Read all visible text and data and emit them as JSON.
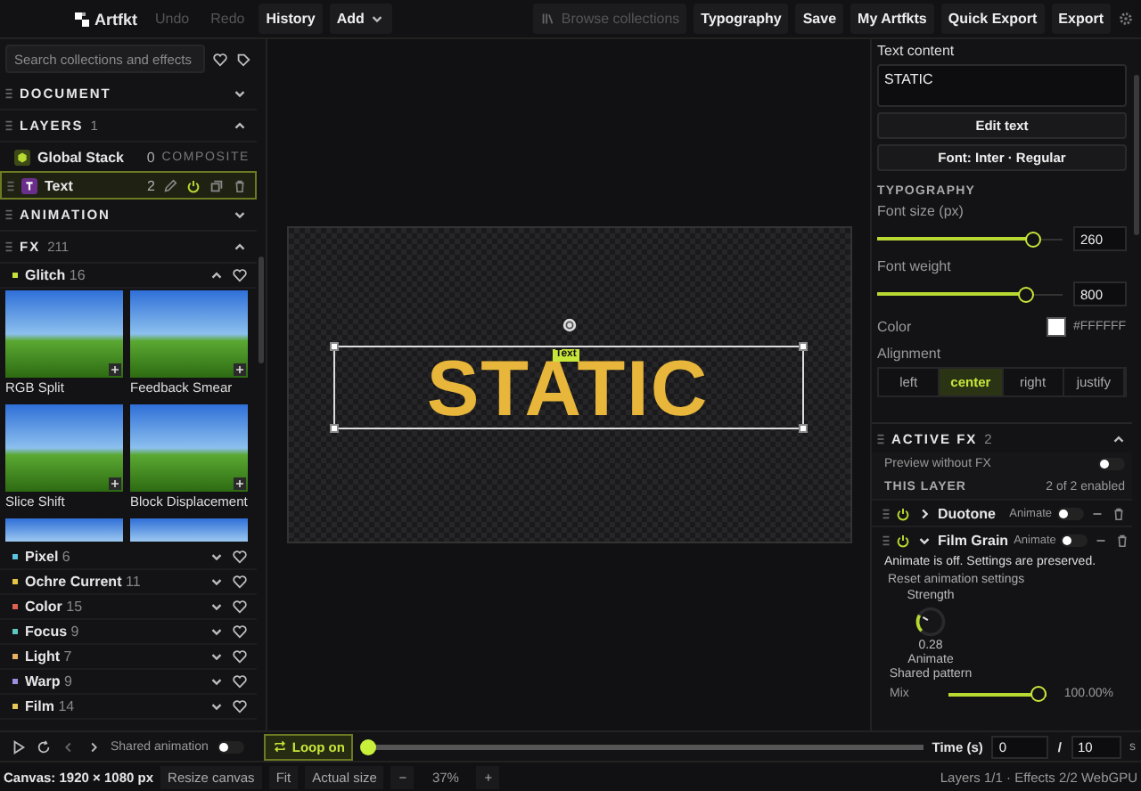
{
  "toolbar": {
    "logo": "Artfkt",
    "left_buttons": [
      {
        "label": "Undo",
        "disabled": true
      },
      {
        "label": "Redo",
        "disabled": true
      },
      {
        "label": "History",
        "disabled": false
      }
    ],
    "add_menu": "Add",
    "right_buttons": [
      {
        "label": "Browse collections",
        "disabled": true,
        "kind": "library"
      },
      {
        "label": "Typography",
        "disabled": false,
        "kind": "plain"
      },
      {
        "label": "Save",
        "disabled": false,
        "kind": "plain"
      },
      {
        "label": "My Artfkts",
        "disabled": false,
        "kind": "plain"
      },
      {
        "label": "Quick Export",
        "disabled": false,
        "kind": "plain"
      },
      {
        "label": "Export",
        "disabled": false,
        "kind": "plain"
      }
    ]
  },
  "left_panel": {
    "search": {
      "placeholder": "Search collections and effects"
    },
    "document": {
      "title": "DOCUMENT",
      "expanded": false
    },
    "layers": {
      "title": "LAYERS",
      "count": "1",
      "expanded": true,
      "items": [
        {
          "name": "Global Stack",
          "count": "0",
          "tag": "COMPOSITE",
          "kind": "stack",
          "selected": false
        },
        {
          "name": "Text",
          "count": "2",
          "kind": "text",
          "selected": true
        }
      ]
    },
    "animation": {
      "title": "ANIMATION",
      "expanded": false
    },
    "fx": {
      "title": "FX",
      "count": "211",
      "expanded": true,
      "categories": [
        {
          "name": "Glitch",
          "count": "16",
          "color": "#c6e03c",
          "expanded": true,
          "effects": [
            {
              "name": "RGB Split"
            },
            {
              "name": "Feedback Smear"
            },
            {
              "name": "Slice Shift"
            },
            {
              "name": "Block Displacement"
            }
          ]
        },
        {
          "name": "Pixel",
          "count": "6",
          "color": "#5cc3e0",
          "expanded": false
        },
        {
          "name": "Ochre Current",
          "count": "11",
          "color": "#e6c444",
          "expanded": false
        },
        {
          "name": "Color",
          "count": "15",
          "color": "#e0604e",
          "expanded": false
        },
        {
          "name": "Focus",
          "count": "9",
          "color": "#5cc9c0",
          "expanded": false
        },
        {
          "name": "Light",
          "count": "7",
          "color": "#e8b060",
          "expanded": false
        },
        {
          "name": "Warp",
          "count": "9",
          "color": "#9a8fe0",
          "expanded": false
        },
        {
          "name": "Film",
          "count": "14",
          "color": "#e6c85a",
          "expanded": false
        }
      ]
    }
  },
  "canvas": {
    "text": "STATIC",
    "tag": "Text"
  },
  "right_panel": {
    "text_content": {
      "label": "Text content",
      "value": "STATIC"
    },
    "buttons": [
      "Edit text",
      "Font: Inter · Regular"
    ],
    "typography": {
      "title": "TYPOGRAPHY",
      "font_size": {
        "label": "Font size (px)",
        "level": 0.87,
        "value": "260"
      },
      "font_weight": {
        "label": "Font weight",
        "level": 0.83,
        "value": "800"
      },
      "color": {
        "label": "Color",
        "value": "#FFFFFF",
        "color": "#ffffff"
      },
      "alignment": {
        "label": "Alignment",
        "options": [
          {
            "label": "left",
            "selected": false
          },
          {
            "label": "center",
            "selected": true
          },
          {
            "label": "right",
            "selected": false
          },
          {
            "label": "justify",
            "selected": false
          }
        ]
      }
    },
    "active_fx": {
      "title": "ACTIVE FX",
      "count": "2",
      "expanded": true,
      "preview": {
        "label": "Preview without FX",
        "on": false
      },
      "this_layer": "THIS LAYER",
      "enabled": "2 of 2 enabled",
      "effects": [
        {
          "name": "Duotone",
          "enabled": true,
          "expanded": false,
          "animate_label": "Animate",
          "animate": false
        },
        {
          "name": "Film Grain",
          "enabled": true,
          "expanded": true,
          "animate_label": "Animate",
          "animate": false
        }
      ],
      "note": "Animate is off. Settings are preserved.",
      "reset": "Reset animation settings",
      "knob": {
        "label": "Strength",
        "level": 0.28,
        "value": "0.28",
        "animate": "Animate",
        "pattern": "Shared pattern"
      },
      "mix": {
        "label": "Mix",
        "level": 1,
        "value": "100.00%"
      }
    }
  },
  "timeline": {
    "shared_animation": {
      "label": "Shared animation",
      "on": false
    },
    "loop": {
      "label": "Loop on",
      "on": true
    },
    "level": 0,
    "time_label": "Time (s)",
    "time": "0",
    "separator": "/",
    "duration": "10",
    "unit": "s"
  },
  "status_bar": {
    "canvas": "Canvas: 1920 × 1080 px",
    "resize": "Resize canvas",
    "fit": "Fit",
    "actual": "Actual size",
    "minus": "−",
    "zoom": "37%",
    "plus": "+",
    "info": "Layers 1/1 · Effects 2/2 WebGPU"
  }
}
